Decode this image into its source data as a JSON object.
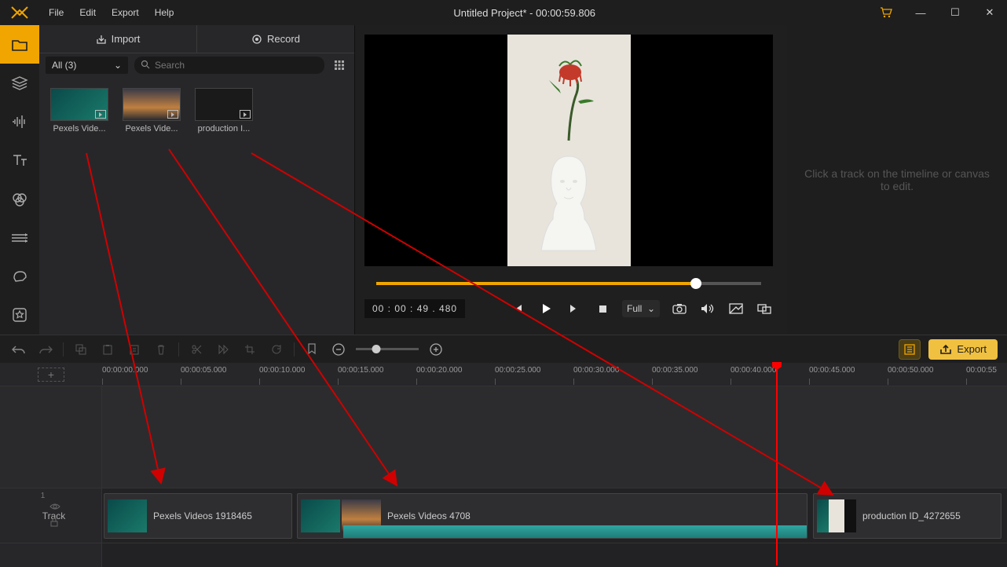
{
  "titlebar": {
    "menus": [
      "File",
      "Edit",
      "Export",
      "Help"
    ],
    "title": "Untitled Project* - 00:00:59.806"
  },
  "media_panel": {
    "tabs": {
      "import": "Import",
      "record": "Record"
    },
    "filter_label": "All (3)",
    "search_placeholder": "Search",
    "items": [
      {
        "label": "Pexels Vide..."
      },
      {
        "label": "Pexels Vide..."
      },
      {
        "label": "production I..."
      }
    ]
  },
  "preview": {
    "timecode": "00 : 00 : 49 . 480",
    "quality": "Full",
    "progress_percent": 83
  },
  "right_hint": "Click a track on the timeline or canvas to edit.",
  "timeline_toolbar": {
    "export_label": "Export"
  },
  "ruler": {
    "ticks": [
      "00:00:00.000",
      "00:00:05.000",
      "00:00:10.000",
      "00:00:15.000",
      "00:00:20.000",
      "00:00:25.000",
      "00:00:30.000",
      "00:00:35.000",
      "00:00:40.000",
      "00:00:45.000",
      "00:00:50.000",
      "00:00:55"
    ]
  },
  "tracks": {
    "label": "Track",
    "index": "1",
    "clips": [
      {
        "label": "Pexels Videos 1918465"
      },
      {
        "label": "Pexels Videos 4708"
      },
      {
        "label": "production ID_4272655"
      }
    ]
  }
}
